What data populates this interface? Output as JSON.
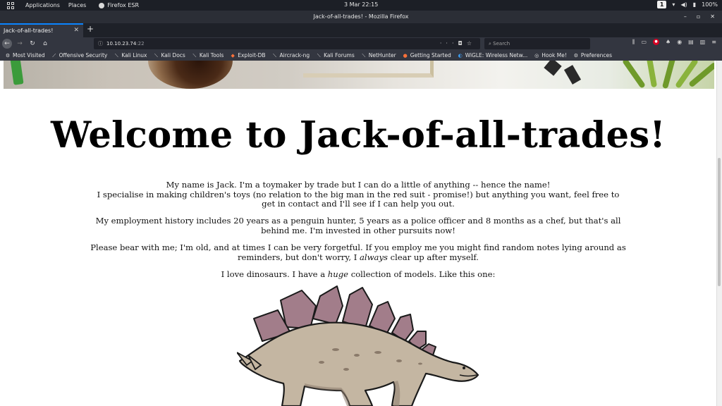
{
  "panel": {
    "applications": "Applications",
    "places": "Places",
    "firefox": "Firefox ESR",
    "clock": "3 Mar  22:15",
    "workspace": "1",
    "battery": "100%"
  },
  "window": {
    "title": "Jack-of-all-trades! - Mozilla Firefox"
  },
  "tabs": [
    {
      "label": "Jack-of-all-trades!"
    }
  ],
  "urlbar": {
    "host": "10.10.23.74",
    "port": ":22"
  },
  "search": {
    "placeholder": "Search"
  },
  "bookmarks": [
    {
      "label": "Most Visited",
      "icon": "gear-icon"
    },
    {
      "label": "Offensive Security",
      "icon": "kali-dragon-icon"
    },
    {
      "label": "Kali Linux",
      "icon": "kali-dragon-icon"
    },
    {
      "label": "Kali Docs",
      "icon": "kali-dragon-icon"
    },
    {
      "label": "Kali Tools",
      "icon": "kali-dragon-icon"
    },
    {
      "label": "Exploit-DB",
      "icon": "exploitdb-icon"
    },
    {
      "label": "Aircrack-ng",
      "icon": "kali-dragon-icon"
    },
    {
      "label": "Kali Forums",
      "icon": "kali-dragon-icon"
    },
    {
      "label": "NetHunter",
      "icon": "kali-dragon-icon"
    },
    {
      "label": "Getting Started",
      "icon": "firefox-icon"
    },
    {
      "label": "WiGLE: Wireless Netw...",
      "icon": "wigle-icon"
    },
    {
      "label": "Hook Me!",
      "icon": "globe-icon"
    },
    {
      "label": "Preferences",
      "icon": "gear-icon"
    }
  ],
  "page": {
    "heading": "Welcome to Jack-of-all-trades!",
    "p1_line1": "My name is Jack. I'm a toymaker by trade but I can do a little of anything -- hence the name!",
    "p1_line2": "I specialise in making children's toys (no relation to the big man in the red suit - promise!) but anything you want, feel free to get in contact and I'll see if I can help you out.",
    "p2": "My employment history includes 20 years as a penguin hunter, 5 years as a police officer and 8 months as a chef, but that's all behind me. I'm invested in other pursuits now!",
    "p3_a": "Please bear with me; I'm old, and at times I can be very forgetful. If you employ me you might find random notes lying around as reminders, but don't worry, I ",
    "p3_em": "always",
    "p3_b": " clear up after myself.",
    "p4_a": "I love dinosaurs. I have a ",
    "p4_em": "huge",
    "p4_b": " collection of models. Like this one:"
  },
  "colors": {
    "accent": "#0a84ff",
    "toolbar": "#333640",
    "panel": "#1c1f26"
  }
}
